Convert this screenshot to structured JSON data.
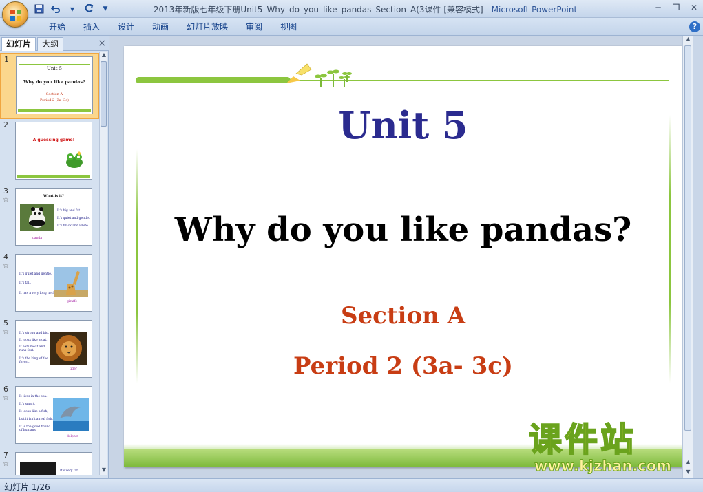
{
  "window": {
    "title": "2013年新版七年级下册Unit5_Why_do_you_like_pandas_Section_A(3课件 [兼容模式]",
    "app_name": "Microsoft PowerPoint",
    "separator": " - "
  },
  "ribbon": {
    "tabs": [
      "开始",
      "插入",
      "设计",
      "动画",
      "幻灯片放映",
      "审阅",
      "视图"
    ],
    "help_label": "?"
  },
  "left_panel": {
    "tabs": [
      "幻灯片",
      "大纲"
    ],
    "close_label": "×",
    "thumbnails": [
      {
        "number": "1",
        "title": "Unit 5",
        "question": "Why do you like pandas?",
        "section": "Section A",
        "period": "Period 2 (3a- 3c)"
      },
      {
        "number": "2",
        "heading": "A guessing game!"
      },
      {
        "number": "3",
        "heading": "What is it?",
        "lines": [
          "It's big and fat.",
          "It's quiet and gentle.",
          "It's black and white."
        ],
        "caption": "panda"
      },
      {
        "number": "4",
        "lines": [
          "It's quiet and gentle.",
          "It's tall.",
          "It has a very long neck."
        ],
        "caption": "giraffe"
      },
      {
        "number": "5",
        "lines": [
          "It's strong and big.",
          "It looks like a cat.",
          "It eats meat and runs fast.",
          "It's the king of the forest."
        ],
        "caption": "tiger"
      },
      {
        "number": "6",
        "lines": [
          "It lives in the sea.",
          "It's smart.",
          "It looks like a fish,",
          "but it isn't a real fish.",
          "It is the good friend of humans."
        ],
        "caption": "dolphin"
      },
      {
        "number": "7",
        "lines": [
          "It's very fat."
        ]
      }
    ]
  },
  "slide": {
    "unit": "Unit 5",
    "question": "Why do you like pandas?",
    "section": "Section A",
    "period": "Period 2 (3a- 3c)"
  },
  "watermark": {
    "chinese": "课件站",
    "url": "www.kjzhan.com"
  },
  "status": {
    "slide_indicator": "幻灯片 1/26"
  },
  "colors": {
    "accent_green": "#8cc63f",
    "title_blue": "#2b2b8f",
    "section_red": "#c83d14",
    "selected_thumb": "#fbd78d"
  }
}
